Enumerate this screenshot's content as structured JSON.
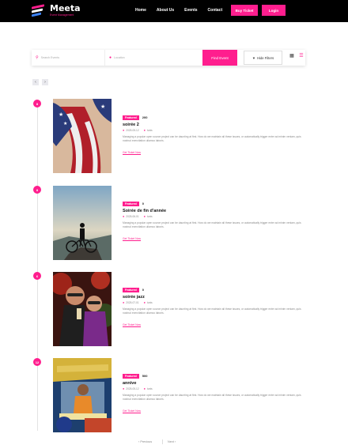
{
  "brand": {
    "name": "Meeta",
    "tagline": "Event Management"
  },
  "nav": {
    "items": [
      "Home",
      "About Us",
      "Events",
      "Contact"
    ]
  },
  "header_buttons": {
    "buy": "Buy Ticket",
    "login": "Login"
  },
  "search": {
    "search_placeholder": "Search Events",
    "location_placeholder": "Location",
    "find_label": "Find Event",
    "filters_label": "Hide Filters"
  },
  "pagination": {
    "prev": "Previous",
    "next": "Next"
  },
  "events": [
    {
      "day": "8",
      "badge": "Featured",
      "count": "200",
      "title": "soirée 2",
      "date": "2025-05-12",
      "location": "tunis",
      "description": "Managing a popular open source project can be daunting at first. How do we maintain all these issues, or automatically trigger enter ad minim veniam, quis nostrud exercitation ullamco laboris.",
      "cta": "Get Ticket Now"
    },
    {
      "day": "8",
      "badge": "Featured",
      "count": "0",
      "title": "Soirée de fin d'année",
      "date": "2025-06-01",
      "location": "tunis",
      "description": "Managing a popular open source project can be daunting at first. How do we maintain all these issues, or automatically trigger enter ad minim veniam, quis nostrud exercitation ullamco laboris.",
      "cta": "Get Ticket Now"
    },
    {
      "day": "6",
      "badge": "Featured",
      "count": "0",
      "title": "soirée jazz",
      "date": "2025-07-01",
      "location": "tunis",
      "description": "Managing a popular open source project can be daunting at first. How do we maintain all these issues, or automatically trigger enter ad minim veniam, quis nostrud exercitation ullamco laboris.",
      "cta": "Get Ticket Now"
    },
    {
      "day": "12",
      "badge": "Featured",
      "count": "500",
      "title": "annive",
      "date": "2025-05-12",
      "location": "tunis",
      "description": "Managing a popular open source project can be daunting at first. How do we maintain all these issues, or automatically trigger enter ad minim veniam, quis nostrud exercitation ullamco laboris.",
      "cta": "Get Ticket Now"
    }
  ]
}
